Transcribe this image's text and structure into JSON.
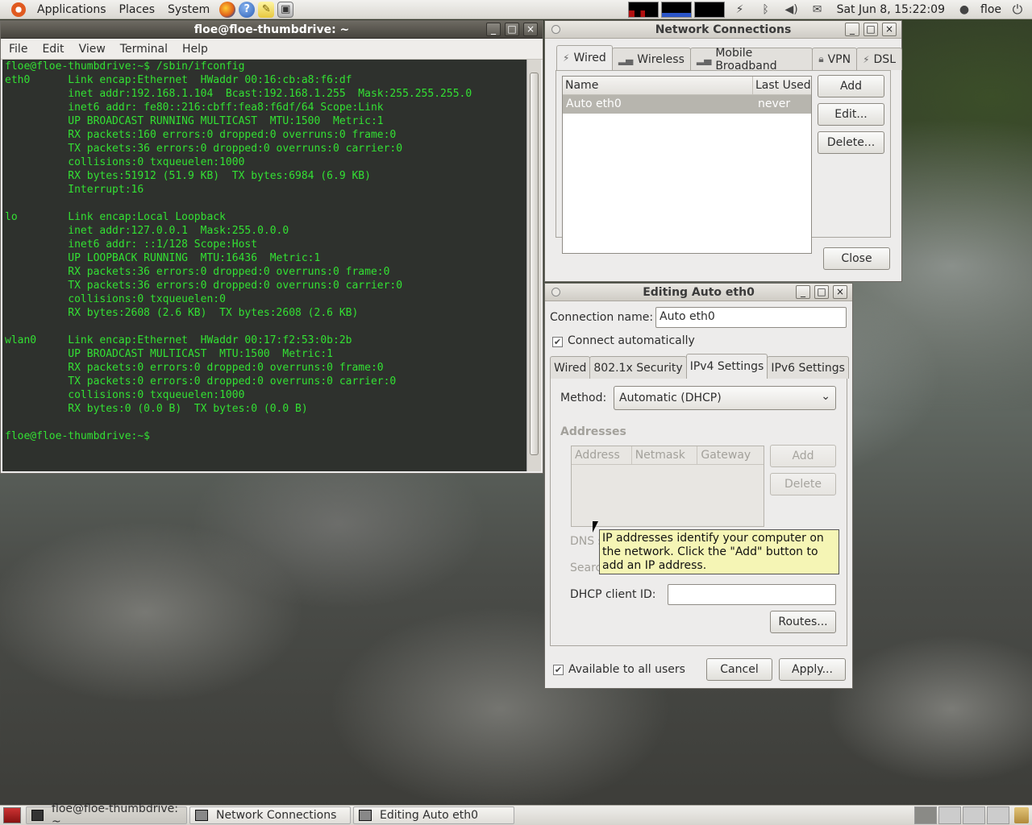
{
  "top_panel": {
    "menus": [
      "Applications",
      "Places",
      "System"
    ],
    "clock": "Sat Jun  8, 15:22:09",
    "user": "floe"
  },
  "terminal": {
    "title": "floe@floe-thumbdrive: ~",
    "menus": [
      "File",
      "Edit",
      "View",
      "Terminal",
      "Help"
    ],
    "lines": [
      "floe@floe-thumbdrive:~$ /sbin/ifconfig",
      "eth0      Link encap:Ethernet  HWaddr 00:16:cb:a8:f6:df",
      "          inet addr:192.168.1.104  Bcast:192.168.1.255  Mask:255.255.255.0",
      "          inet6 addr: fe80::216:cbff:fea8:f6df/64 Scope:Link",
      "          UP BROADCAST RUNNING MULTICAST  MTU:1500  Metric:1",
      "          RX packets:160 errors:0 dropped:0 overruns:0 frame:0",
      "          TX packets:36 errors:0 dropped:0 overruns:0 carrier:0",
      "          collisions:0 txqueuelen:1000",
      "          RX bytes:51912 (51.9 KB)  TX bytes:6984 (6.9 KB)",
      "          Interrupt:16",
      "",
      "lo        Link encap:Local Loopback",
      "          inet addr:127.0.0.1  Mask:255.0.0.0",
      "          inet6 addr: ::1/128 Scope:Host",
      "          UP LOOPBACK RUNNING  MTU:16436  Metric:1",
      "          RX packets:36 errors:0 dropped:0 overruns:0 frame:0",
      "          TX packets:36 errors:0 dropped:0 overruns:0 carrier:0",
      "          collisions:0 txqueuelen:0",
      "          RX bytes:2608 (2.6 KB)  TX bytes:2608 (2.6 KB)",
      "",
      "wlan0     Link encap:Ethernet  HWaddr 00:17:f2:53:0b:2b",
      "          UP BROADCAST MULTICAST  MTU:1500  Metric:1",
      "          RX packets:0 errors:0 dropped:0 overruns:0 frame:0",
      "          TX packets:0 errors:0 dropped:0 overruns:0 carrier:0",
      "          collisions:0 txqueuelen:1000",
      "          RX bytes:0 (0.0 B)  TX bytes:0 (0.0 B)",
      "",
      "floe@floe-thumbdrive:~$"
    ]
  },
  "netconn": {
    "title": "Network Connections",
    "tabs": [
      "Wired",
      "Wireless",
      "Mobile Broadband",
      "VPN",
      "DSL"
    ],
    "columns": [
      "Name",
      "Last Used"
    ],
    "rows": [
      {
        "name": "Auto eth0",
        "last_used": "never"
      }
    ],
    "buttons": {
      "add": "Add",
      "edit": "Edit...",
      "delete": "Delete...",
      "close": "Close"
    }
  },
  "editing": {
    "title": "Editing Auto eth0",
    "connection_name_label": "Connection name:",
    "connection_name_value": "Auto eth0",
    "connect_auto_label": "Connect automatically",
    "tabs": [
      "Wired",
      "802.1x Security",
      "IPv4 Settings",
      "IPv6 Settings"
    ],
    "method_label": "Method:",
    "method_value": "Automatic (DHCP)",
    "addresses_label": "Addresses",
    "addr_columns": [
      "Address",
      "Netmask",
      "Gateway"
    ],
    "addr_add": "Add",
    "addr_delete": "Delete",
    "dns_label_partial": "DNS s",
    "search_label_partial": "Searc",
    "dhcp_label": "DHCP client ID:",
    "dhcp_value": "",
    "routes_button": "Routes...",
    "available_label": "Available to all users",
    "cancel_button": "Cancel",
    "apply_button": "Apply...",
    "tooltip": "IP addresses identify your computer on the network.  Click the \"Add\" button to add an IP address."
  },
  "taskbar": {
    "tasks": [
      "floe@floe-thumbdrive: ~",
      "Network Connections",
      "Editing Auto eth0"
    ]
  }
}
